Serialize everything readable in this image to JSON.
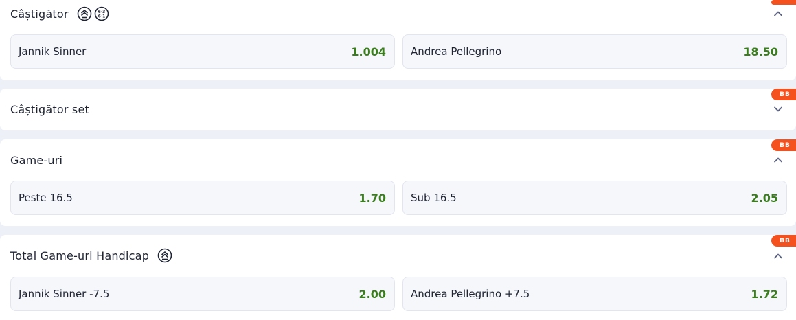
{
  "colors": {
    "page_bg": "#eef0f7",
    "card_bg": "#ffffff",
    "odds_green": "#3a7d1d",
    "bb_badge": "#f4511e",
    "text": "#1f2433"
  },
  "markets": [
    {
      "title": "Câștigător",
      "icons": [
        "bet-builder-icon",
        "score-stats-icon"
      ],
      "badge": "BB",
      "expanded": true,
      "chevron": "chevron-up-icon",
      "outcomes": [
        {
          "name": "Jannik Sinner",
          "odds": "1.004"
        },
        {
          "name": "Andrea Pellegrino",
          "odds": "18.50"
        }
      ]
    },
    {
      "title": "Câștigător set",
      "icons": [],
      "badge": "BB",
      "expanded": false,
      "chevron": "chevron-down-icon",
      "outcomes": []
    },
    {
      "title": "Game-uri",
      "icons": [],
      "badge": "BB",
      "expanded": true,
      "chevron": "chevron-up-icon",
      "outcomes": [
        {
          "name": "Peste 16.5",
          "odds": "1.70"
        },
        {
          "name": "Sub 16.5",
          "odds": "2.05"
        }
      ]
    },
    {
      "title": "Total Game-uri Handicap",
      "icons": [
        "bet-builder-icon"
      ],
      "badge": "BB",
      "expanded": true,
      "chevron": "chevron-up-icon",
      "outcomes": [
        {
          "name": "Jannik Sinner -7.5",
          "odds": "2.00"
        },
        {
          "name": "Andrea Pellegrino +7.5",
          "odds": "1.72"
        }
      ]
    }
  ]
}
